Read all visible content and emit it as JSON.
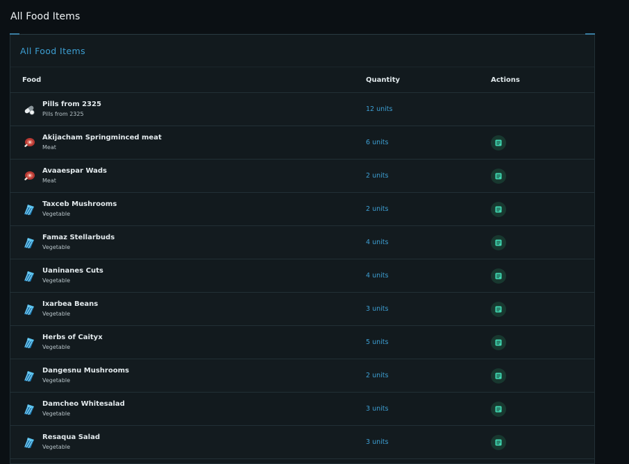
{
  "page": {
    "title": "All Food Items"
  },
  "panel": {
    "title": "All Food Items"
  },
  "table": {
    "columns": {
      "food": "Food",
      "quantity": "Quantity",
      "actions": "Actions"
    },
    "rows": [
      {
        "name": "Pills from 2325",
        "type": "Pills from 2325",
        "quantity": "12 units",
        "icon": "pills-icon",
        "has_action": false
      },
      {
        "name": "Akijacham Springminced meat",
        "type": "Meat",
        "quantity": "6 units",
        "icon": "meat-icon",
        "has_action": true
      },
      {
        "name": "Avaaespar Wads",
        "type": "Meat",
        "quantity": "2 units",
        "icon": "meat-icon",
        "has_action": true
      },
      {
        "name": "Taxceb Mushrooms",
        "type": "Vegetable",
        "quantity": "2 units",
        "icon": "vegetable-icon",
        "has_action": true
      },
      {
        "name": "Famaz Stellarbuds",
        "type": "Vegetable",
        "quantity": "4 units",
        "icon": "vegetable-icon",
        "has_action": true
      },
      {
        "name": "Uaninanes Cuts",
        "type": "Vegetable",
        "quantity": "4 units",
        "icon": "vegetable-icon",
        "has_action": true
      },
      {
        "name": "Ixarbea Beans",
        "type": "Vegetable",
        "quantity": "3 units",
        "icon": "vegetable-icon",
        "has_action": true
      },
      {
        "name": "Herbs of Caityx",
        "type": "Vegetable",
        "quantity": "5 units",
        "icon": "vegetable-icon",
        "has_action": true
      },
      {
        "name": "Dangesnu Mushrooms",
        "type": "Vegetable",
        "quantity": "2 units",
        "icon": "vegetable-icon",
        "has_action": true
      },
      {
        "name": "Damcheo Whitesalad",
        "type": "Vegetable",
        "quantity": "3 units",
        "icon": "vegetable-icon",
        "has_action": true
      },
      {
        "name": "Resaqua Salad",
        "type": "Vegetable",
        "quantity": "3 units",
        "icon": "vegetable-icon",
        "has_action": true
      }
    ]
  },
  "colors": {
    "accent": "#3d9fd3",
    "action_bg": "#18382f",
    "action_fg": "#3fd6b0",
    "background": "#0b1014",
    "panel": "#121a1e"
  }
}
